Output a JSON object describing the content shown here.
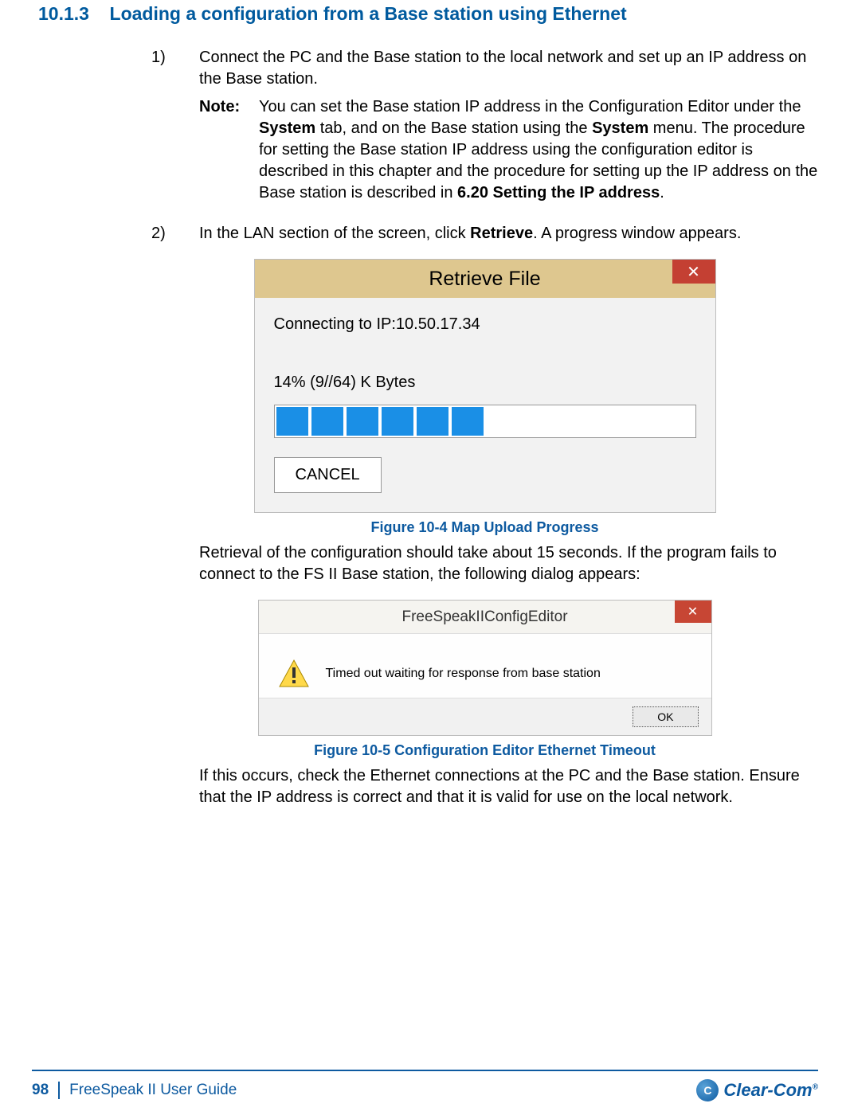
{
  "section": {
    "number": "10.1.3",
    "title": "Loading a configuration from a Base station using Ethernet"
  },
  "items": [
    {
      "num": "1)",
      "text": "Connect the PC and the Base station to the local network and set up an IP address on the Base station."
    },
    {
      "num": "2)",
      "text_before": "In the LAN section of the screen, click ",
      "bold": "Retrieve",
      "text_after": ". A progress window appears."
    }
  ],
  "note": {
    "label": "Note:",
    "parts": {
      "t1": "You can set the Base station IP address in the Configuration Editor under the ",
      "b1": "System",
      "t2": " tab, and on the Base station using the ",
      "b2": "System",
      "t3": " menu. The procedure for setting the Base station IP address using the configuration editor is described in this chapter and the procedure for setting up the IP address on the Base station is described in ",
      "b3": "6.20 Setting the IP address",
      "t4": "."
    }
  },
  "dialog1": {
    "title": "Retrieve File",
    "connecting": "Connecting to IP:10.50.17.34",
    "progress_text": "14%   (9//64) K Bytes",
    "cancel": "CANCEL",
    "progress_blocks": 6
  },
  "figure1": "Figure 10-4 Map Upload Progress",
  "para1": "Retrieval of the configuration should take about 15 seconds. If the program fails to connect to the FS II Base station, the following dialog appears:",
  "dialog2": {
    "title": "FreeSpeakIIConfigEditor",
    "message": "Timed out waiting for response from base station",
    "ok": "OK"
  },
  "figure2": "Figure 10-5 Configuration Editor Ethernet Timeout",
  "para2": "If this occurs, check the Ethernet connections at the PC and the Base station. Ensure that the IP address is correct and that it is valid for use on the local network.",
  "footer": {
    "page": "98",
    "guide": "FreeSpeak II User Guide",
    "logo_text": "Clear-Com",
    "logo_symbol": "C"
  }
}
